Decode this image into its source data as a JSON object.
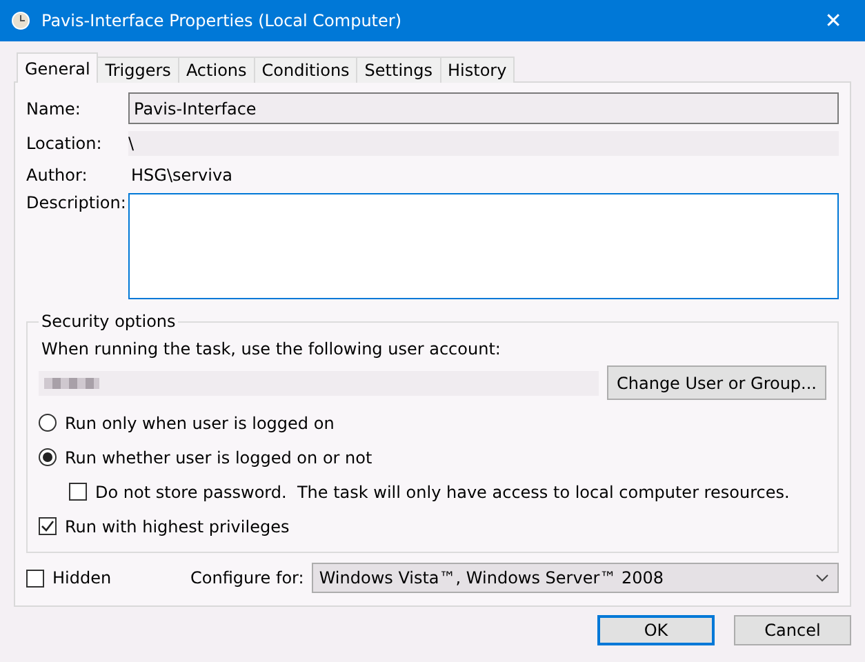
{
  "window": {
    "title": "Pavis-Interface Properties (Local Computer)",
    "close": "✕"
  },
  "tabs": [
    {
      "label": "General",
      "selected": true
    },
    {
      "label": "Triggers",
      "selected": false
    },
    {
      "label": "Actions",
      "selected": false
    },
    {
      "label": "Conditions",
      "selected": false
    },
    {
      "label": "Settings",
      "selected": false
    },
    {
      "label": "History",
      "selected": false
    }
  ],
  "fields": {
    "name_label": "Name:",
    "name_value": "Pavis-Interface",
    "location_label": "Location:",
    "location_value": "\\",
    "author_label": "Author:",
    "author_value": "HSG\\serviva",
    "description_label": "Description:"
  },
  "security": {
    "title": "Security options",
    "account_prompt": "When running the task, use the following user account:",
    "change_button": "Change User or Group...",
    "options": [
      {
        "kind": "radio",
        "label": "Run only when user is logged on",
        "selected": false,
        "indent": false
      },
      {
        "kind": "radio",
        "label": "Run whether user is logged on or not",
        "selected": true,
        "indent": false
      },
      {
        "kind": "checkbox",
        "label": "Do not store password.  The task will only have access to local computer resources.",
        "checked": false,
        "indent": true
      },
      {
        "kind": "checkbox",
        "label": "Run with highest privileges",
        "checked": true,
        "indent": false
      }
    ]
  },
  "hidden": {
    "label": "Hidden",
    "checked": false
  },
  "configure": {
    "label": "Configure for:",
    "value": "Windows Vista™, Windows Server™ 2008"
  },
  "buttons": [
    {
      "label": "OK",
      "default": true
    },
    {
      "label": "Cancel",
      "default": false
    }
  ]
}
